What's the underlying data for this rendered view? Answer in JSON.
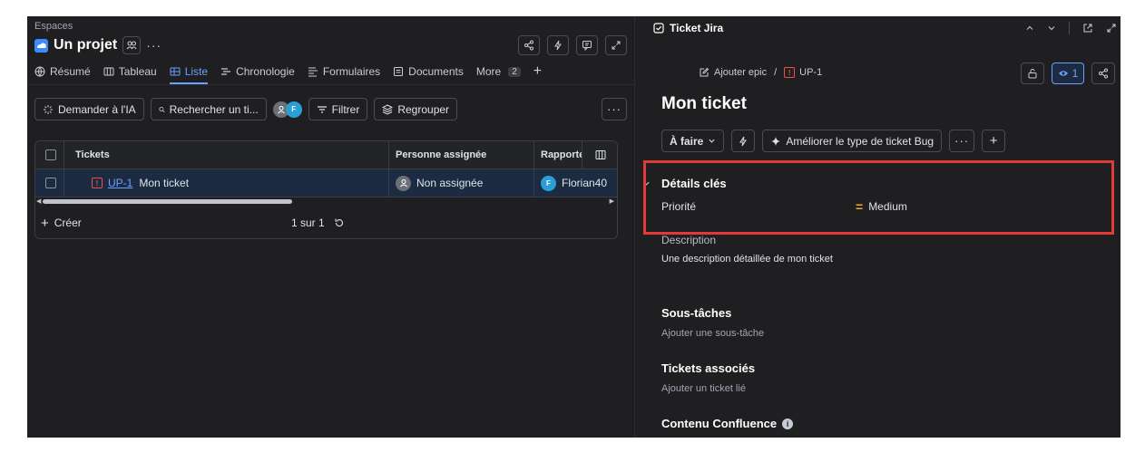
{
  "left": {
    "spaces_label": "Espaces",
    "project_title": "Un projet",
    "tabs": [
      {
        "label": "Résumé",
        "icon": "globe-icon"
      },
      {
        "label": "Tableau",
        "icon": "board-icon"
      },
      {
        "label": "Liste",
        "icon": "list-icon",
        "active": true
      },
      {
        "label": "Chronologie",
        "icon": "timeline-icon"
      },
      {
        "label": "Formulaires",
        "icon": "forms-icon"
      },
      {
        "label": "Documents",
        "icon": "documents-icon"
      }
    ],
    "more_label": "More",
    "more_count": "2",
    "toolbar": {
      "ask_ai": "Demander à l'IA",
      "search_text": "Rechercher un ti...",
      "avatar_initial": "F",
      "filter": "Filtrer",
      "group": "Regrouper"
    },
    "table": {
      "headers": {
        "tickets": "Tickets",
        "assignee": "Personne assignée",
        "reporter": "Rapporte"
      },
      "rows": [
        {
          "key": "UP-1",
          "summary": "Mon ticket",
          "assignee": "Non assignée",
          "reporter_initial": "F",
          "reporter": "Florian40"
        }
      ],
      "create_label": "Créer",
      "pagination": "1 sur 1"
    }
  },
  "right": {
    "panel_title": "Ticket Jira",
    "breadcrumb_epic": "Ajouter epic",
    "breadcrumb_sep": "/",
    "breadcrumb_key": "UP-1",
    "watch_count": "1",
    "ticket_title": "Mon ticket",
    "status": "À faire",
    "improve_label": "Améliorer le type de ticket Bug",
    "details_heading": "Détails clés",
    "priority_label": "Priorité",
    "priority_mark": "=",
    "priority_value": "Medium",
    "description_label": "Description",
    "description_text": "Une description détaillée de mon ticket",
    "subtasks_heading": "Sous-tâches",
    "subtasks_hint": "Ajouter une sous-tâche",
    "linked_heading": "Tickets associés",
    "linked_hint": "Ajouter un ticket lié",
    "confluence_heading": "Contenu Confluence",
    "info_glyph": "i"
  },
  "colors": {
    "bg": "#1f1f21",
    "accent": "#6aa0ff",
    "row_selected": "#1c2b41",
    "highlight": "#e03a3a",
    "priority": "#f5a623",
    "bug": "#e5534b"
  }
}
